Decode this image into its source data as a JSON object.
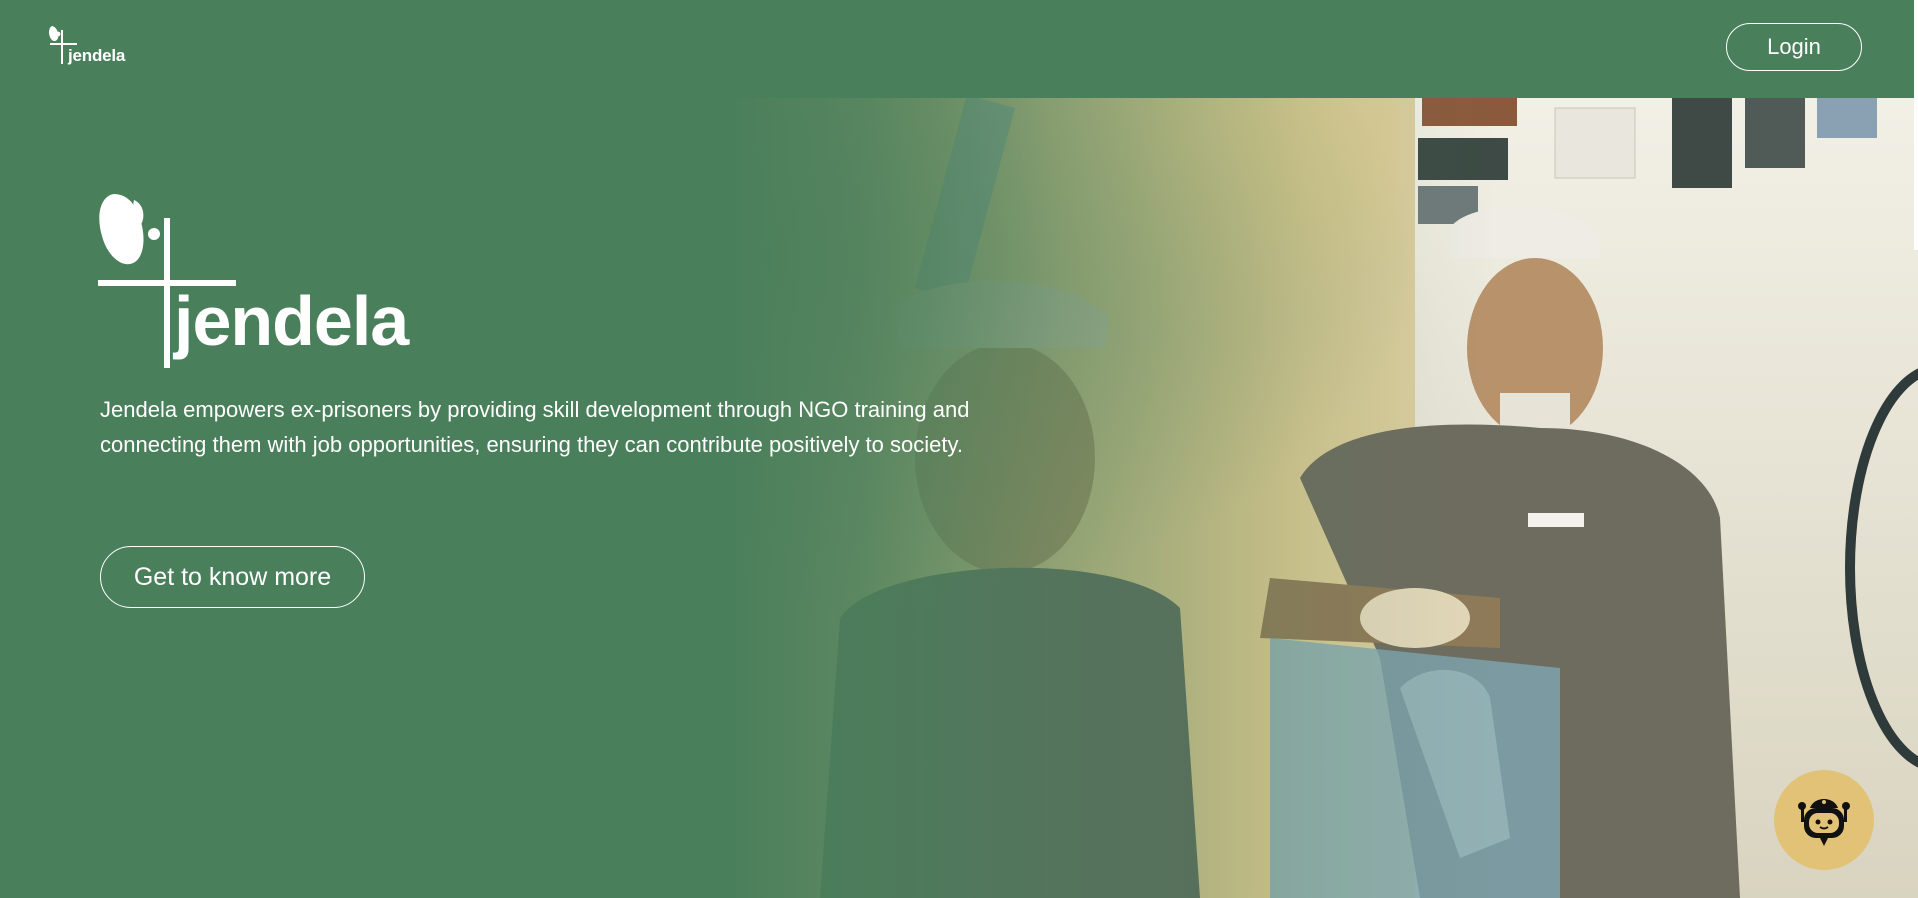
{
  "header": {
    "logo_text": "jendela",
    "login_label": "Login"
  },
  "hero": {
    "logo_text": "jendela",
    "description": "Jendela empowers ex-prisoners by providing skill development through NGO training and connecting them with job opportunities, ensuring they can contribute positively to society.",
    "cta_label": "Get to know more"
  },
  "icons": {
    "brand_logo": "butterfly-cross-icon",
    "chatbot": "robot-chat-icon"
  },
  "colors": {
    "brand_green": "#4a7f5b",
    "chatbot_bg": "#e2c277",
    "text": "#ffffff"
  }
}
